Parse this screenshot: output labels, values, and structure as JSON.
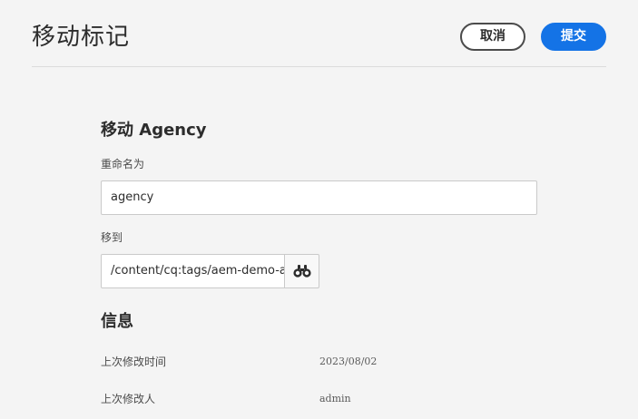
{
  "header": {
    "title": "移动标记",
    "cancel_label": "取消",
    "submit_label": "提交"
  },
  "form": {
    "heading": "移动 Agency",
    "rename_label": "重命名为",
    "rename_value": "agency",
    "move_to_label": "移到",
    "move_to_value": "/content/cq:tags/aem-demo-assets",
    "browse_icon": "binoculars-icon"
  },
  "info": {
    "heading": "信息",
    "rows": [
      {
        "label": "上次修改时间",
        "value": "2023/08/02"
      },
      {
        "label": "上次修改人",
        "value": "admin"
      }
    ]
  },
  "colors": {
    "accent": "#1473e6",
    "background": "#f4f4f4"
  }
}
